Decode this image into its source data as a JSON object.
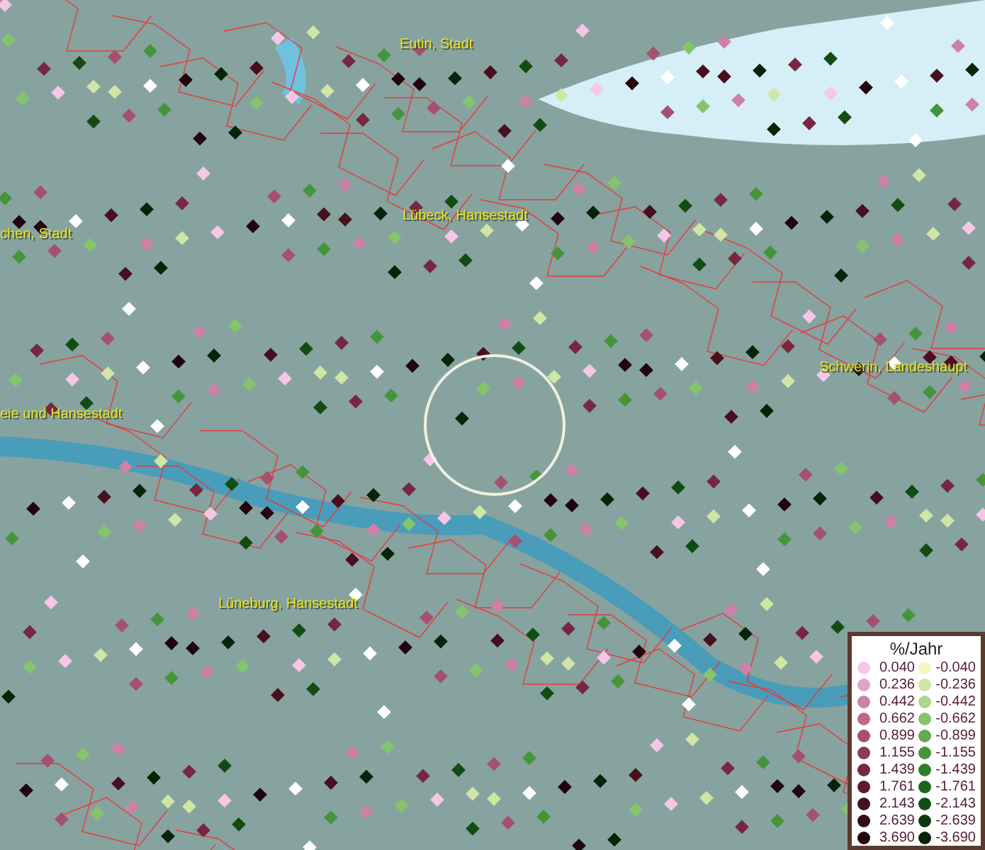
{
  "map": {
    "places": [
      {
        "name": "Eutin, Stadt",
        "kind": "town"
      },
      {
        "name": "Lübeck, Hansestadt",
        "kind": "town"
      },
      {
        "name": "chen, Stadt",
        "kind": "town"
      },
      {
        "name": "Schwerin, Landeshaupt",
        "kind": "town"
      },
      {
        "name": "eie und Hansestadt",
        "kind": "town"
      },
      {
        "name": "Lüneburg, Hansestadt",
        "kind": "town"
      }
    ]
  },
  "legend": {
    "title": "%/Jahr",
    "columns": [
      [
        {
          "value": "0.040",
          "color": "#f7c6e6"
        },
        {
          "value": "0.236",
          "color": "#e3a0c8"
        },
        {
          "value": "0.442",
          "color": "#cf80a6"
        },
        {
          "value": "0.662",
          "color": "#bb6a8a"
        },
        {
          "value": "0.899",
          "color": "#a65070"
        },
        {
          "value": "1.155",
          "color": "#8e3a58"
        },
        {
          "value": "1.439",
          "color": "#772840"
        },
        {
          "value": "1.761",
          "color": "#5e1a2c"
        },
        {
          "value": "2.143",
          "color": "#48101e"
        },
        {
          "value": "2.639",
          "color": "#350a14"
        },
        {
          "value": "3.690",
          "color": "#22050c"
        }
      ],
      [
        {
          "value": "-0.040",
          "color": "#f2f7c2"
        },
        {
          "value": "-0.236",
          "color": "#cfe6a4"
        },
        {
          "value": "-0.442",
          "color": "#aad88a"
        },
        {
          "value": "-0.662",
          "color": "#86c46c"
        },
        {
          "value": "-0.899",
          "color": "#62ab50"
        },
        {
          "value": "-1.155",
          "color": "#46943a"
        },
        {
          "value": "-1.439",
          "color": "#2f7c28"
        },
        {
          "value": "-1.761",
          "color": "#1f641c"
        },
        {
          "value": "-2.143",
          "color": "#124c12"
        },
        {
          "value": "-2.639",
          "color": "#0a380c"
        },
        {
          "value": "-3.690",
          "color": "#052408"
        }
      ]
    ]
  }
}
